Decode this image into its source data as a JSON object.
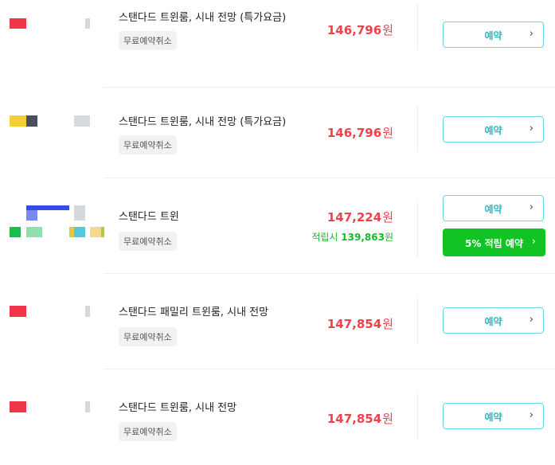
{
  "listings": [
    {
      "room_name": "스탠다드 트윈룸, 시내 전망 (특가요금)",
      "badge": "무료예약취소",
      "price": "146,796",
      "currency": "원",
      "book_label": "예약",
      "chevron": "›"
    },
    {
      "room_name": "스탠다드 트윈룸, 시내 전망 (특가요금)",
      "badge": "무료예약취소",
      "price": "146,796",
      "currency": "원",
      "book_label": "예약",
      "chevron": "›"
    },
    {
      "room_name": "스탠다드 트윈",
      "badge": "무료예약취소",
      "price": "147,224",
      "currency": "원",
      "point_label": "적립시",
      "point_value": "139,863",
      "point_currency": "원",
      "book_label": "예약",
      "chevron": "›",
      "point_button_label": "5% 적립 예약",
      "point_button_chevron": "›"
    },
    {
      "room_name": "스탠다드 패밀리 트윈룸, 시내 전망",
      "badge": "무료예약취소",
      "price": "147,854",
      "currency": "원",
      "book_label": "예약",
      "chevron": "›"
    },
    {
      "room_name": "스탠다드 트윈룸, 시내 전망",
      "badge": "무료예약취소",
      "price": "147,854",
      "currency": "원",
      "book_label": "예약",
      "chevron": "›"
    }
  ],
  "colors": {
    "price": "#f0414b",
    "point": "#18b92b",
    "book_border": "#6ad7de",
    "book_text": "#2bb8c1",
    "point_button": "#11c423"
  }
}
